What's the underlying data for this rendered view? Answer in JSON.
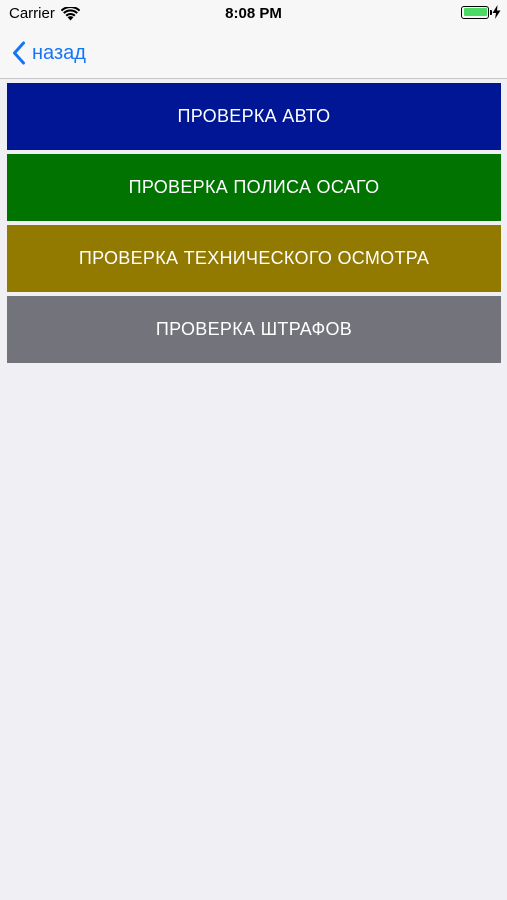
{
  "status_bar": {
    "carrier": "Carrier",
    "time": "8:08 PM",
    "battery_level": 1.0,
    "battery_color": "#4cd964"
  },
  "nav": {
    "back_label": "назад",
    "back_color": "#1476f5"
  },
  "menu": {
    "items": [
      {
        "label": "ПРОВЕРКА АВТО",
        "color": "#001694"
      },
      {
        "label": "ПРОВЕРКА ПОЛИСА ОСАГО",
        "color": "#017301"
      },
      {
        "label": "ПРОВЕРКА ТЕХНИЧЕСКОГО ОСМОТРА",
        "color": "#927a01"
      },
      {
        "label": "ПРОВЕРКА ШТРАФОВ",
        "color": "#73737b"
      }
    ]
  },
  "icons": {
    "wifi": "wifi-icon",
    "battery": "battery-icon",
    "charging": "bolt-icon",
    "back": "chevron-left-icon"
  }
}
